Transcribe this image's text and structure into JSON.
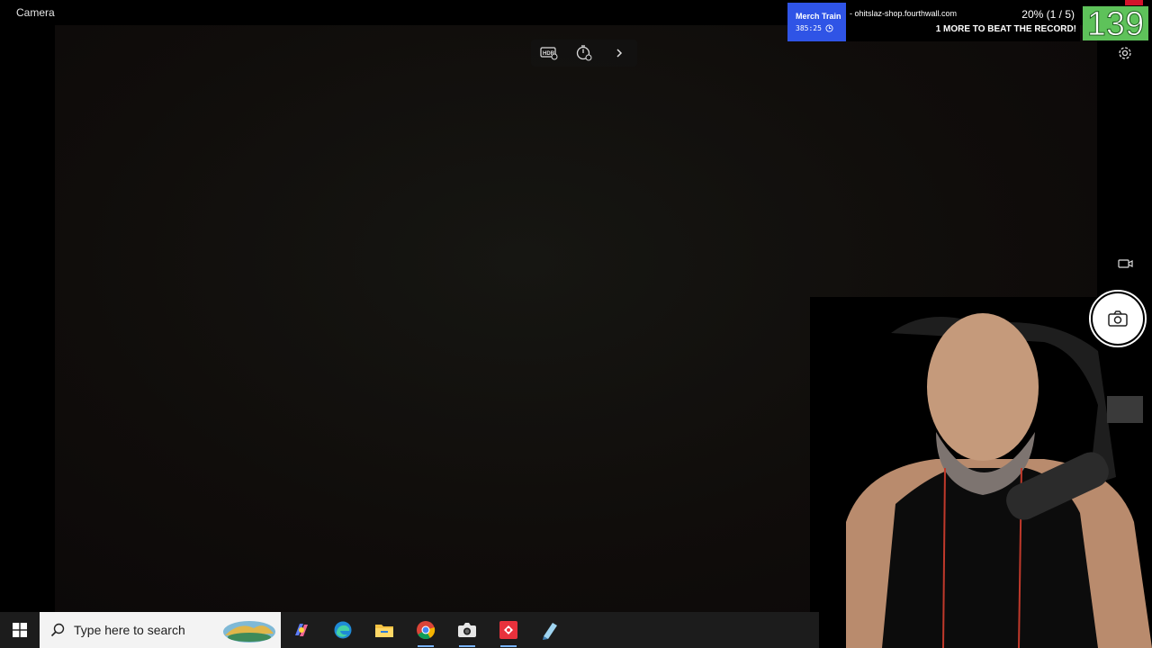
{
  "app": {
    "title": "Camera"
  },
  "toolbar": {
    "hdr_icon": "hdr-icon",
    "timer_icon": "timer-icon",
    "more_icon": "chevron-right-icon"
  },
  "overlay": {
    "title": "Merch Train",
    "site": " - ohitslaz-shop.fourthwall.com",
    "timer": "385:25",
    "progress": "20% (1 / 5)",
    "record": "1 MORE TO BEAT THE RECORD!",
    "counter": "139",
    "accent": "#2f54e6",
    "counter_color": "#5ec25a"
  },
  "controls": {
    "settings_icon": "gear-icon",
    "video_icon": "video-camera-icon",
    "shutter_icon": "camera-icon"
  },
  "taskbar": {
    "search_placeholder": "Type here to search",
    "apps": [
      "copilot-icon",
      "edge-icon",
      "file-explorer-icon",
      "chrome-icon",
      "camera-app-icon",
      "red-app-icon",
      "notepad-icon"
    ]
  }
}
